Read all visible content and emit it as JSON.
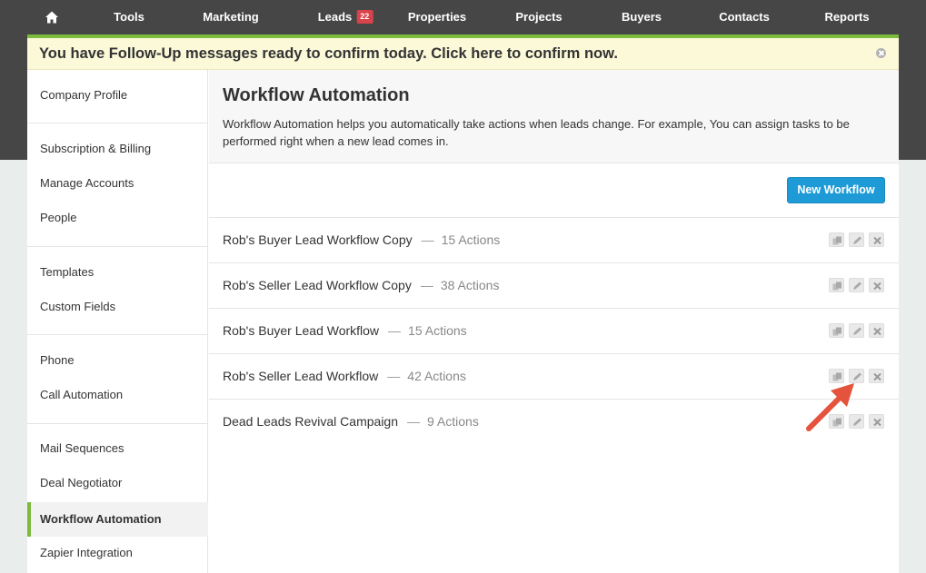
{
  "nav": {
    "home_icon": "home-icon",
    "tools": "Tools",
    "marketing": "Marketing",
    "leads": "Leads",
    "leads_badge": "22",
    "properties": "Properties",
    "projects": "Projects",
    "buyers": "Buyers",
    "contacts": "Contacts",
    "reports": "Reports"
  },
  "banner": {
    "text": "You have Follow-Up messages ready to confirm today. Click here to confirm now.",
    "close_icon": "close-icon"
  },
  "sidebar": {
    "items": [
      {
        "label": "Company Profile"
      },
      {
        "label": "Subscription & Billing"
      },
      {
        "label": "Manage Accounts"
      },
      {
        "label": "People"
      },
      {
        "label": "Templates"
      },
      {
        "label": "Custom Fields"
      },
      {
        "label": "Phone"
      },
      {
        "label": "Call Automation"
      },
      {
        "label": "Mail Sequences"
      },
      {
        "label": "Deal Negotiator"
      },
      {
        "label": "Workflow Automation"
      },
      {
        "label": "Zapier Integration"
      }
    ],
    "active": "Workflow Automation"
  },
  "main": {
    "title": "Workflow Automation",
    "description": "Workflow Automation helps you automatically take actions when leads change. For example, You can assign tasks to be performed right when a new lead comes in.",
    "new_button": "New Workflow",
    "separator": "—",
    "workflows": [
      {
        "name": "Rob's Buyer Lead Workflow Copy",
        "actions": "15 Actions"
      },
      {
        "name": "Rob's Seller Lead Workflow Copy",
        "actions": "38 Actions"
      },
      {
        "name": "Rob's Buyer Lead Workflow",
        "actions": "15 Actions"
      },
      {
        "name": "Rob's Seller Lead Workflow",
        "actions": "42 Actions"
      },
      {
        "name": "Dead Leads Revival Campaign",
        "actions": "9 Actions"
      }
    ],
    "row_action_icons": [
      "copy-icon",
      "pencil-icon",
      "close-icon"
    ]
  },
  "colors": {
    "nav_bg": "#464646",
    "accent_green": "#7dbb3c",
    "banner_bg": "#fbf9d8",
    "button_blue": "#1e9bd6",
    "badge_red": "#d9434b",
    "arrow_red": "#e5533c"
  }
}
